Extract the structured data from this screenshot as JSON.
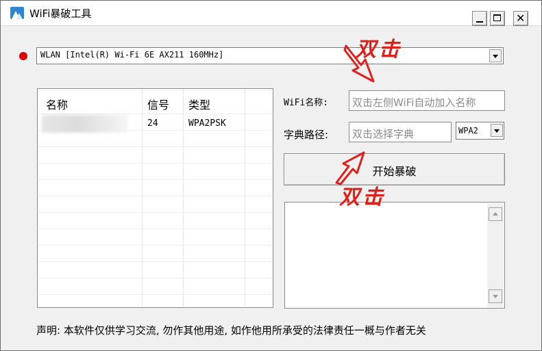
{
  "window": {
    "title": "WiFi暴破工具"
  },
  "adapter": {
    "value": "WLAN [Intel(R) Wi-Fi 6E AX211 160MHz]",
    "status_color": "#e00000"
  },
  "network_list": {
    "columns": [
      "名称",
      "信号",
      "类型"
    ],
    "rows": [
      {
        "name": "",
        "signal": "24",
        "type": "WPA2PSK"
      }
    ]
  },
  "form": {
    "wifi_name_label": "WiFi名称:",
    "wifi_name_placeholder": "双击左侧WiFi自动加入名称",
    "dict_path_label": "字典路径:",
    "dict_path_placeholder": "双击选择字典",
    "auth_type": "WPA2"
  },
  "start_button": {
    "label": "开始暴破"
  },
  "annotations": {
    "top": "双击",
    "bottom": "双击",
    "color": "#e0201a"
  },
  "disclaimer": "声明: 本软件仅供学习交流, 勿作其他用途, 如作他用所承受的法律责任一概与作者无关"
}
